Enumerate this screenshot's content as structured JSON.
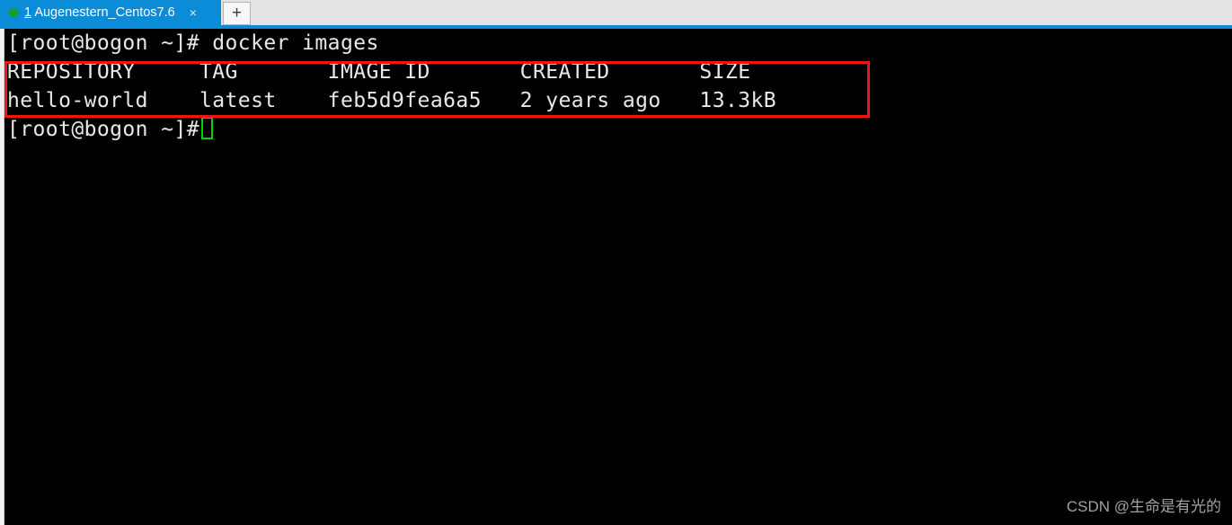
{
  "window": {
    "tab_bar": {
      "tabs": [
        {
          "index_label": "1",
          "title": "Augenestern_Centos7.6",
          "status_dot_color": "#17a01a",
          "close_label": "×",
          "active": true
        }
      ],
      "new_tab_label": "+",
      "active_tab_color": "#0a8cd8",
      "bar_color": "#e3e3e3"
    }
  },
  "terminal": {
    "background_color": "#000000",
    "text_color": "#e8e8e8",
    "cursor_color": "#00d400",
    "lines": [
      "[root@bogon ~]# docker images",
      "REPOSITORY     TAG       IMAGE ID       CREATED       SIZE",
      "hello-world    latest    feb5d9fea6a5   2 years ago   13.3kB",
      "[root@bogon ~]# "
    ],
    "prompt": "[root@bogon ~]#",
    "command": "docker images",
    "table": {
      "headers": [
        "REPOSITORY",
        "TAG",
        "IMAGE ID",
        "CREATED",
        "SIZE"
      ],
      "rows": [
        {
          "repository": "hello-world",
          "tag": "latest",
          "image_id": "feb5d9fea6a5",
          "created": "2 years ago",
          "size": "13.3kB"
        }
      ]
    },
    "annotation": {
      "type": "rectangle",
      "color": "#f01414",
      "covers": "docker images output table"
    }
  },
  "watermark": {
    "text": "CSDN @生命是有光的"
  }
}
